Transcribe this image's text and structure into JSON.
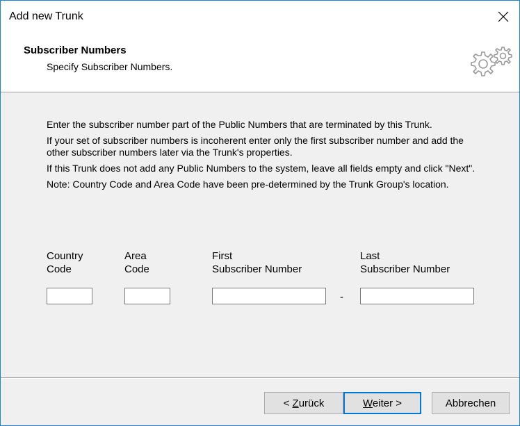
{
  "window": {
    "title": "Add new Trunk"
  },
  "header": {
    "title": "Subscriber Numbers",
    "subtitle": "Specify Subscriber Numbers."
  },
  "instructions": [
    "Enter the subscriber number part of the Public Numbers that are terminated by this Trunk.",
    "If your set of subscriber numbers is incoherent enter only the first subscriber number and add the other subscriber numbers later via the Trunk's properties.",
    "If this Trunk does not add any Public Numbers to the system, leave all fields empty and click \"Next\".",
    "Note: Country Code and Area Code have been pre-determined by the Trunk Group's location."
  ],
  "fields": {
    "country_code": {
      "label_line1": "Country",
      "label_line2": "Code",
      "value": ""
    },
    "area_code": {
      "label_line1": "Area",
      "label_line2": "Code",
      "value": ""
    },
    "first_subscriber": {
      "label_line1": "First",
      "label_line2": "Subscriber Number",
      "value": ""
    },
    "last_subscriber": {
      "label_line1": "Last",
      "label_line2": "Subscriber Number",
      "value": ""
    },
    "range_separator": "-"
  },
  "buttons": {
    "back": {
      "prefix": "< ",
      "mnemonic": "Z",
      "rest": "urück"
    },
    "next": {
      "mnemonic": "W",
      "rest": "eiter >"
    },
    "cancel": {
      "label": "Abbrechen"
    }
  },
  "icons": {
    "close": "close-icon",
    "header": "gears-icon"
  }
}
